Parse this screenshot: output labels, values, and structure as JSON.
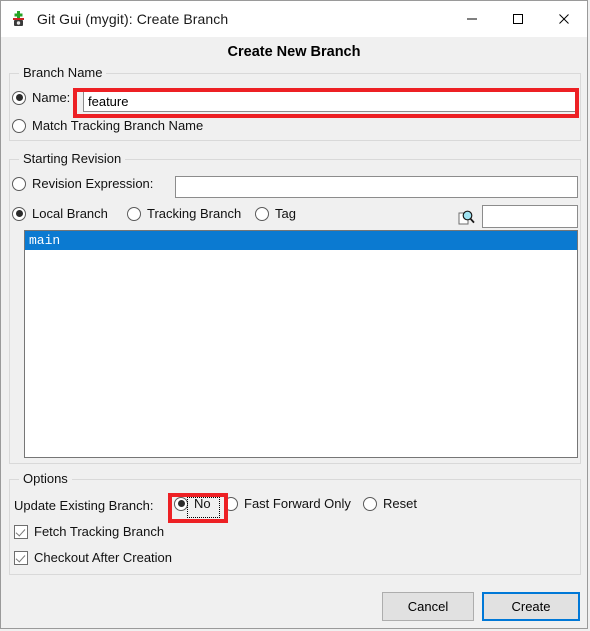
{
  "window": {
    "title": "Git Gui (mygit): Create Branch",
    "app_icon": "git-gui-icon",
    "controls": {
      "minimize": "minimize-icon",
      "maximize": "maximize-icon",
      "close": "close-icon"
    }
  },
  "heading": "Create New Branch",
  "branch_name": {
    "group_label": "Branch Name",
    "name_radio_label": "Name:",
    "name_radio_selected": true,
    "name_value": "feature",
    "name_placeholder": "",
    "match_tracking_label": "Match Tracking Branch Name",
    "match_tracking_selected": false
  },
  "starting_revision": {
    "group_label": "Starting Revision",
    "revision_expression_label": "Revision Expression:",
    "revision_expression_selected": false,
    "revision_expression_value": "",
    "local_branch_label": "Local Branch",
    "local_branch_selected": true,
    "tracking_branch_label": "Tracking Branch",
    "tracking_branch_selected": false,
    "tag_label": "Tag",
    "tag_selected": false,
    "search_icon": "magnifier-icon",
    "filter_value": "",
    "list_items": [
      {
        "label": "main",
        "selected": true
      }
    ]
  },
  "options": {
    "group_label": "Options",
    "update_existing_label": "Update Existing Branch:",
    "update_no_label": "No",
    "update_no_selected": true,
    "update_ff_label": "Fast Forward Only",
    "update_ff_selected": false,
    "update_reset_label": "Reset",
    "update_reset_selected": false,
    "fetch_tracking_label": "Fetch Tracking Branch",
    "fetch_tracking_checked": true,
    "checkout_after_label": "Checkout After Creation",
    "checkout_after_checked": true
  },
  "footer": {
    "cancel_label": "Cancel",
    "create_label": "Create"
  },
  "annotations": {
    "accent_red": "#ed2024",
    "selection_blue": "#0b7ad1",
    "focus_blue": "#0078d7"
  }
}
